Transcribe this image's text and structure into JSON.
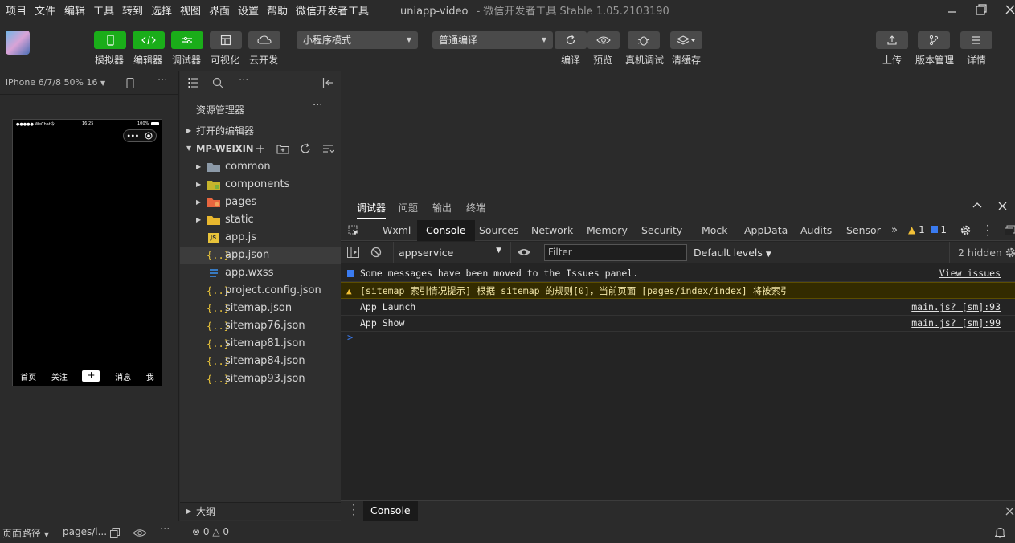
{
  "menu": [
    "项目",
    "文件",
    "编辑",
    "工具",
    "转到",
    "选择",
    "视图",
    "界面",
    "设置",
    "帮助",
    "微信开发者工具"
  ],
  "window": {
    "title_main": "uniapp-video",
    "title_sub": "- 微信开发者工具 Stable 1.05.2103190"
  },
  "toolbar": {
    "modes": [
      {
        "label": "模拟器",
        "icon": "phone-icon"
      },
      {
        "label": "编辑器",
        "icon": "code-icon"
      },
      {
        "label": "调试器",
        "icon": "debug-icon"
      },
      {
        "label": "可视化",
        "icon": "layout-icon"
      },
      {
        "label": "云开发",
        "icon": "cloud-icon"
      }
    ],
    "mode_select": "小程序模式",
    "compile_select": "普通编译",
    "actions": [
      "编译",
      "预览",
      "真机调试",
      "清缓存"
    ],
    "right_actions": [
      "上传",
      "版本管理",
      "详情"
    ]
  },
  "simulator": {
    "device": "iPhone 6/7/8 50% 16",
    "status_left": "●●●●● WeChat令",
    "status_time": "16:25",
    "status_right": "100%",
    "tabbar": [
      "首页",
      "关注",
      "+",
      "消息",
      "我"
    ]
  },
  "explorer": {
    "title": "资源管理器",
    "open_editors": "打开的编辑器",
    "project": "MP-WEIXIN",
    "folders": [
      "common",
      "components",
      "pages",
      "static"
    ],
    "files": [
      "app.js",
      "app.json",
      "app.wxss",
      "project.config.json",
      "sitemap.json",
      "sitemap76.json",
      "sitemap81.json",
      "sitemap84.json",
      "sitemap93.json"
    ],
    "selected_file": "app.json",
    "outline": "大纲"
  },
  "debugger": {
    "tabs": [
      "调试器",
      "问题",
      "输出",
      "终端"
    ],
    "devtools_tabs": [
      "Wxml",
      "Console",
      "Sources",
      "Network",
      "Memory",
      "Security",
      "Mock",
      "AppData",
      "Audits",
      "Sensor"
    ],
    "active_tab": "Console",
    "warn_count": "1",
    "info_count": "1",
    "context": "appservice",
    "filter_placeholder": "Filter",
    "levels": "Default levels",
    "hidden": "2 hidden",
    "messages": {
      "issues_note": "Some messages have been moved to the Issues panel.",
      "issues_link": "View issues",
      "warning": "[sitemap 索引情况提示] 根据 sitemap 的规则[0]，当前页面 [pages/index/index] 将被索引",
      "log1": "App Launch",
      "log1_src": "main.js? [sm]:93",
      "log2": "App Show",
      "log2_src": "main.js? [sm]:99"
    },
    "prompt": ">",
    "drawer_tab": "Console"
  },
  "statusbar": {
    "path_label": "页面路径",
    "path_value": "pages/i...",
    "errors": "0",
    "warnings": "0"
  },
  "colors": {
    "accent_green": "#1aad19",
    "warn_bg": "#332b00",
    "info_blue": "#3a7bf0"
  }
}
